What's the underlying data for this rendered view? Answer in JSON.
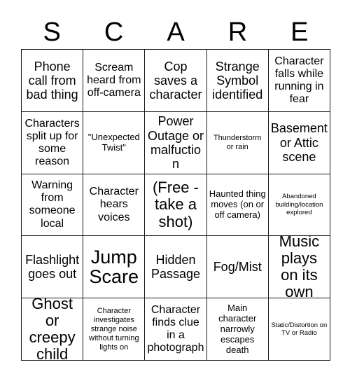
{
  "card": {
    "header_letters": [
      "S",
      "C",
      "A",
      "R",
      "E"
    ],
    "colors": {
      "text": "#000000",
      "border": "#1a1a1a",
      "cell_background": "#ffffff",
      "page_background": "#ffffff"
    },
    "rows": [
      [
        {
          "text": "Phone call from bad thing",
          "size": "lg"
        },
        {
          "text": "Scream heard from off-camera",
          "size": "md"
        },
        {
          "text": "Cop saves a character",
          "size": "lg"
        },
        {
          "text": "Strange Symbol identified",
          "size": "lg"
        },
        {
          "text": "Character falls while running in fear",
          "size": "md"
        }
      ],
      [
        {
          "text": "Characters split up for some reason",
          "size": "md"
        },
        {
          "text": "\"Unexpected Twist\"",
          "size": "sm"
        },
        {
          "text": "Power Outage or malfuction",
          "size": "lg"
        },
        {
          "text": "Thunderstorm or rain",
          "size": "xs"
        },
        {
          "text": "Basement or Attic scene",
          "size": "lg"
        }
      ],
      [
        {
          "text": "Warning from someone local",
          "size": "md"
        },
        {
          "text": "Character hears voices",
          "size": "md"
        },
        {
          "text": "(Free - take a shot)",
          "size": "xl"
        },
        {
          "text": "Haunted thing moves (on or off camera)",
          "size": "sm"
        },
        {
          "text": "Abandoned building/location explored",
          "size": "xxs"
        }
      ],
      [
        {
          "text": "Flashlight goes out",
          "size": "lg"
        },
        {
          "text": "Jump Scare",
          "size": "xxl"
        },
        {
          "text": "Hidden Passage",
          "size": "lg"
        },
        {
          "text": "Fog/Mist",
          "size": "lg"
        },
        {
          "text": "Music plays on its own",
          "size": "xl"
        }
      ],
      [
        {
          "text": "Ghost or creepy child",
          "size": "xl"
        },
        {
          "text": "Character investigates strange noise without turning lights on",
          "size": "xs"
        },
        {
          "text": "Character finds clue in a photograph",
          "size": "md"
        },
        {
          "text": "Main character narrowly escapes death",
          "size": "sm"
        },
        {
          "text": "Static/Distortion on TV or Radio",
          "size": "xxs"
        }
      ]
    ]
  }
}
